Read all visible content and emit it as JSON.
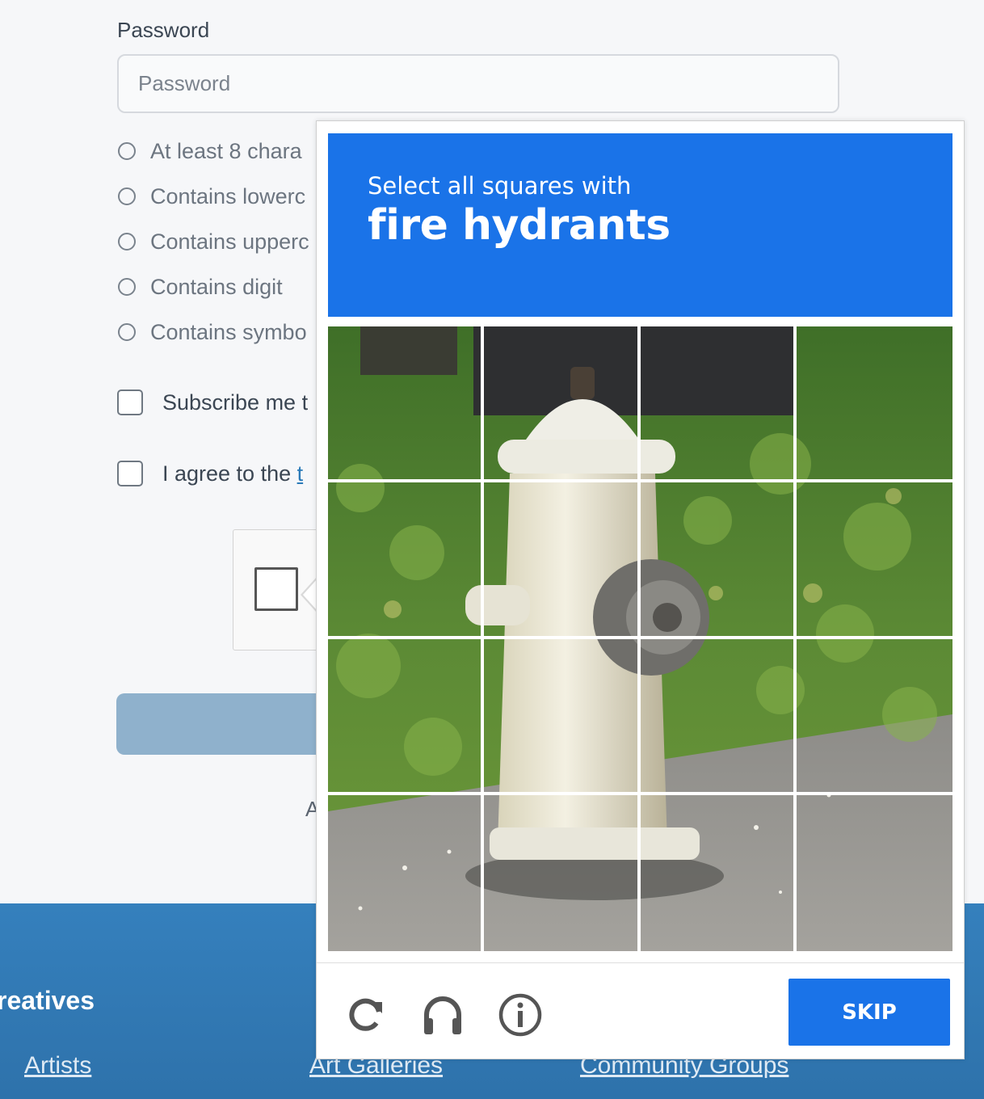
{
  "form": {
    "password_label": "Password",
    "password_placeholder": "Password",
    "password_value": "",
    "rules": [
      "At least 8 chara",
      "Contains lowerc",
      "Contains upperc",
      "Contains digit",
      "Contains symbo"
    ],
    "subscribe_label": "Subscribe me t",
    "agree_label": "I agree to the ",
    "agree_link": "t",
    "account_text": "A"
  },
  "footer": {
    "heading": "reatives",
    "links": [
      "Artists",
      "Art Galleries",
      "Community Groups"
    ]
  },
  "captcha": {
    "instruction": "Select all squares with",
    "target": "fire hydrants",
    "skip_label": "SKIP",
    "header_color": "#1a73e8",
    "icons": [
      "reload-icon",
      "audio-headphones-icon",
      "info-icon"
    ]
  },
  "colors": {
    "accent": "#1a73e8",
    "footer_bg": "#2e72ab",
    "submit_disabled": "#8fb1cc"
  }
}
